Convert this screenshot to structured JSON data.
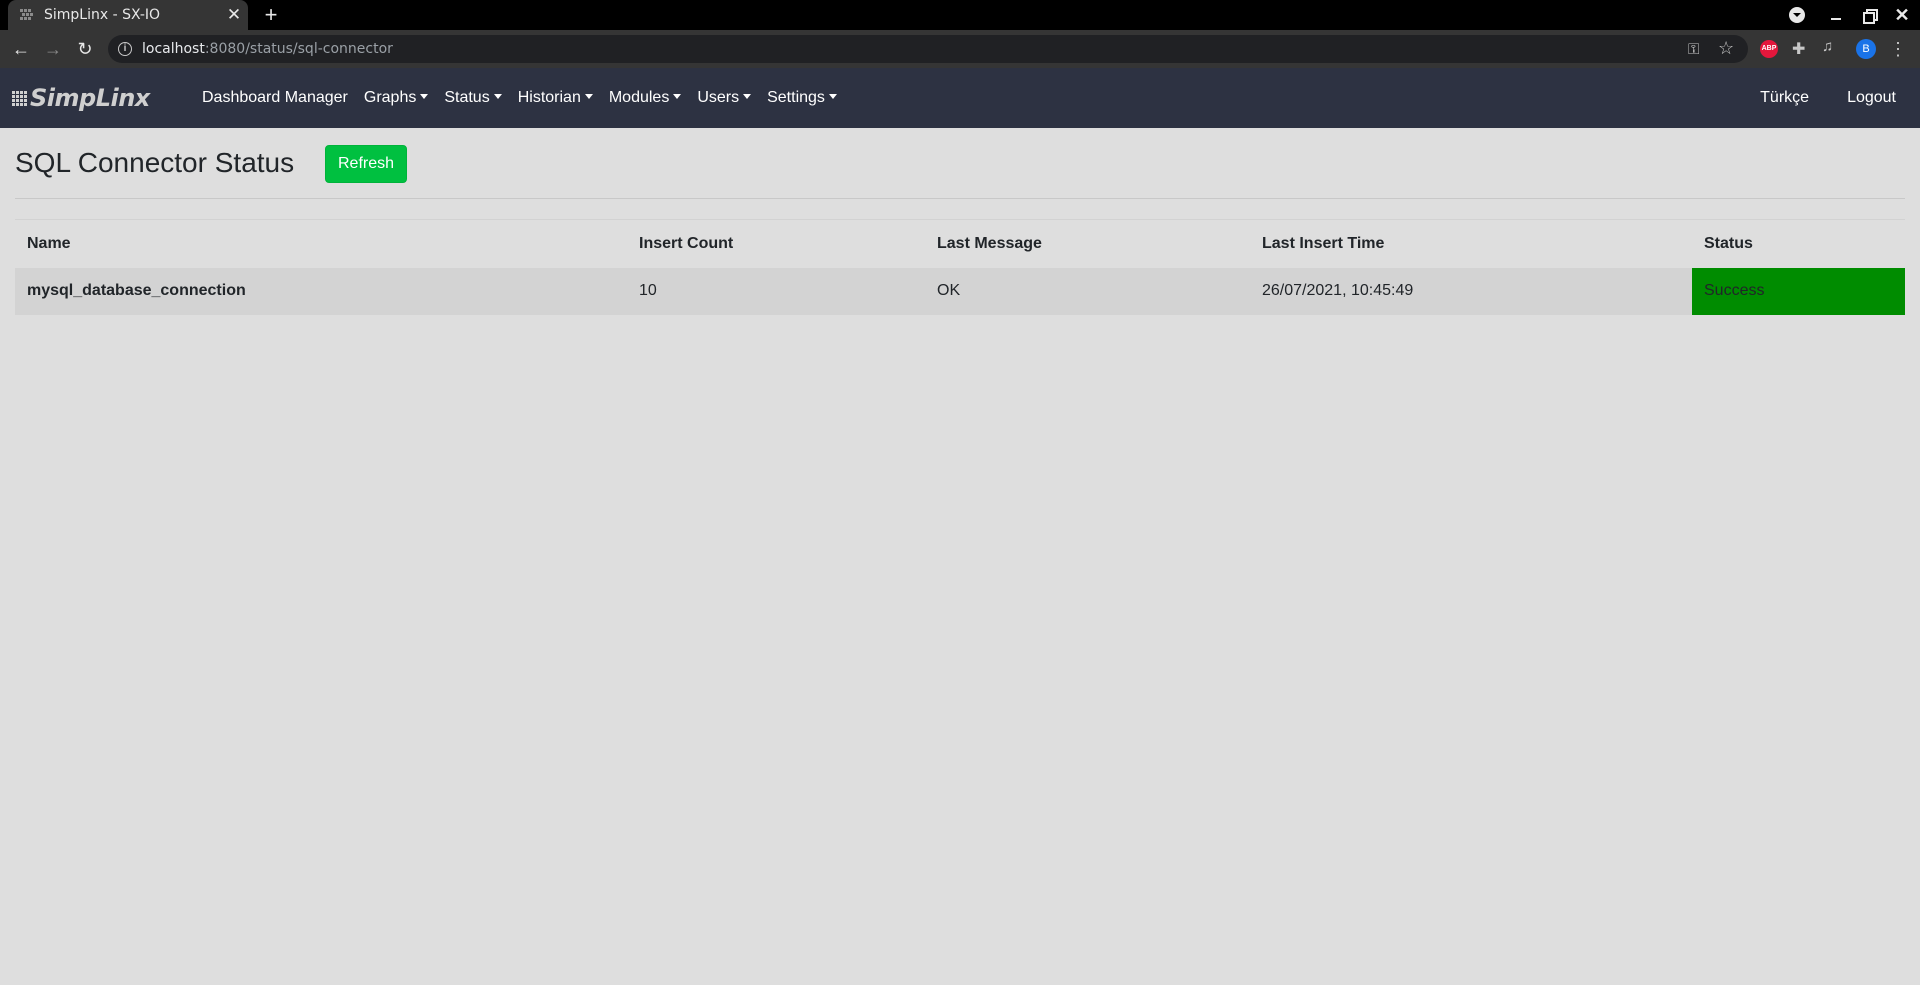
{
  "browser": {
    "tab_title": "SimpLinx - SX-IO",
    "url_host": "localhost",
    "url_path": ":8080/status/sql-connector",
    "profile_initial": "B",
    "abp_label": "ABP"
  },
  "navbar": {
    "brand": "SimpLinx",
    "items": [
      {
        "label": "Dashboard Manager",
        "dropdown": false
      },
      {
        "label": "Graphs",
        "dropdown": true
      },
      {
        "label": "Status",
        "dropdown": true
      },
      {
        "label": "Historian",
        "dropdown": true
      },
      {
        "label": "Modules",
        "dropdown": true
      },
      {
        "label": "Users",
        "dropdown": true
      },
      {
        "label": "Settings",
        "dropdown": true
      }
    ],
    "language": "Türkçe",
    "logout": "Logout"
  },
  "page": {
    "title": "SQL Connector Status",
    "refresh_label": "Refresh"
  },
  "table": {
    "headers": [
      "Name",
      "Insert Count",
      "Last Message",
      "Last Insert Time",
      "Status"
    ],
    "rows": [
      {
        "name": "mysql_database_connection",
        "insert_count": "10",
        "last_message": "OK",
        "last_insert_time": "26/07/2021, 10:45:49",
        "status": "Success"
      }
    ]
  },
  "colors": {
    "navbar_bg": "#2d3242",
    "refresh_button": "#00c040",
    "status_success": "#008c00",
    "page_bg": "#dedede"
  }
}
